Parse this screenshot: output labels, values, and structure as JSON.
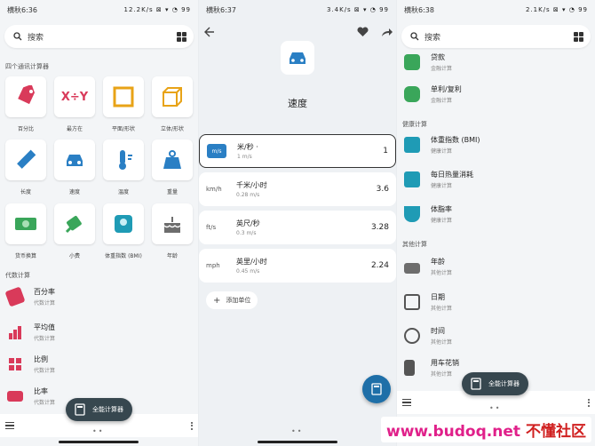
{
  "panels": {
    "left": {
      "status_time": "横秋6:36",
      "status_right": "12.2K/s ⊠ ▾ ◔ 99",
      "search_placeholder": "搜索",
      "section_common": "四个通讯计算器",
      "tiles": [
        {
          "label": "百分比",
          "icon": "tag-icon"
        },
        {
          "label": "最方在",
          "icon": "xy-icon"
        },
        {
          "label": "平面/形状",
          "icon": "square-icon"
        },
        {
          "label": "立体/形状",
          "icon": "cube-icon"
        },
        {
          "label": "长度",
          "icon": "ruler-icon"
        },
        {
          "label": "速度",
          "icon": "car-icon"
        },
        {
          "label": "温度",
          "icon": "thermometer-icon"
        },
        {
          "label": "重量",
          "icon": "weight-icon"
        },
        {
          "label": "货币换算",
          "icon": "money-icon"
        },
        {
          "label": "小费",
          "icon": "tip-icon"
        },
        {
          "label": "体重指数 (BMI)",
          "icon": "scale-icon"
        },
        {
          "label": "年龄",
          "icon": "cake-icon"
        }
      ],
      "section_algebra": "代数计算",
      "list": [
        {
          "title": "百分率",
          "sub": "代数计算",
          "icon": "tag-icon"
        },
        {
          "title": "平均值",
          "sub": "代数计算",
          "icon": "bar-chart-icon"
        },
        {
          "title": "比例",
          "sub": "代数计算",
          "icon": "grid-icon"
        },
        {
          "title": "比率",
          "sub": "代数计算",
          "icon": "ratio-icon"
        }
      ],
      "fab_label": "全能计算器"
    },
    "middle": {
      "status_time": "横秋6:37",
      "status_right": "3.4K/s ⊠ ▾ ◔ 99",
      "title": "速度",
      "units": [
        {
          "symbol": "m/s",
          "name": "米/秒 ·",
          "sub": "1 m/s",
          "value": "1"
        },
        {
          "symbol": "km/h",
          "name": "千米/小时",
          "sub": "0.28 m/s",
          "value": "3.6"
        },
        {
          "symbol": "ft/s",
          "name": "英尺/秒",
          "sub": "0.3 m/s",
          "value": "3.28"
        },
        {
          "symbol": "mph",
          "name": "英里/小时",
          "sub": "0.45 m/s",
          "value": "2.24"
        }
      ],
      "add_label": "添加单位"
    },
    "right": {
      "status_time": "横秋6:38",
      "status_right": "2.1K/s ⊠ ▾ ◔ 99",
      "search_placeholder": "搜索",
      "top_items": [
        {
          "title": "贷款",
          "sub": "金融计算"
        },
        {
          "title": "单利/复利",
          "sub": "金融计算"
        }
      ],
      "section_health": "健康计算",
      "health_items": [
        {
          "title": "体重指数 (BMI)",
          "sub": "健康计算"
        },
        {
          "title": "每日热量消耗",
          "sub": "健康计算"
        },
        {
          "title": "体脂率",
          "sub": "健康计算"
        }
      ],
      "section_other": "其他计算",
      "other_items": [
        {
          "title": "年龄",
          "sub": "其他计算"
        },
        {
          "title": "日期",
          "sub": "其他计算"
        },
        {
          "title": "时间",
          "sub": "其他计算"
        },
        {
          "title": "用车花销",
          "sub": "其他计算"
        }
      ],
      "fab_label": "全能计算器"
    }
  },
  "watermark": {
    "site": "www.budoq.net",
    "cn": "不懂社区"
  },
  "colors": {
    "accent": "#1e6fa8",
    "fab": "#37474f",
    "pink": "#e0208a"
  }
}
